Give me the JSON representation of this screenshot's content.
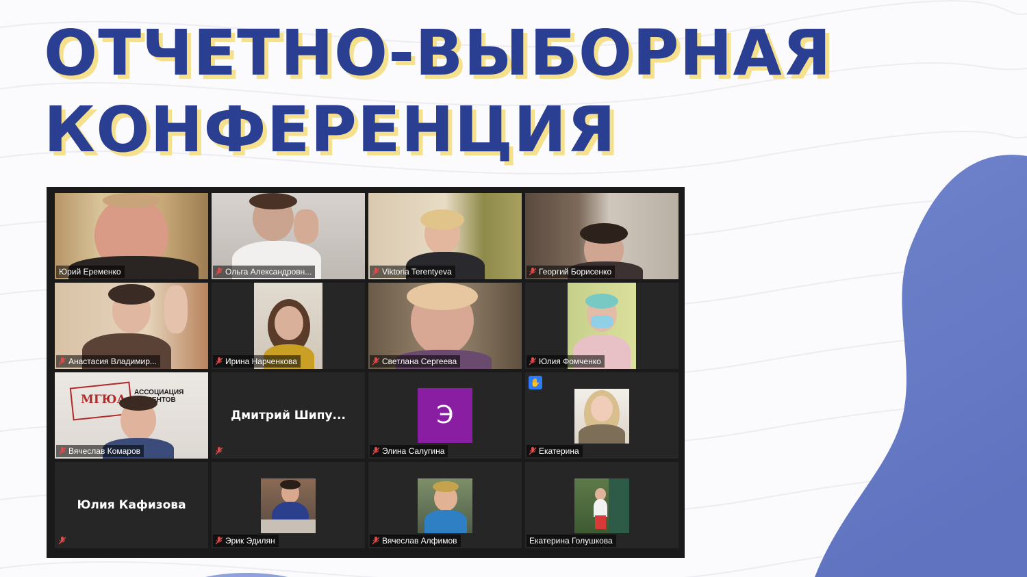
{
  "slide": {
    "title_line1": "ОТЧЕТНО-ВЫБОРНАЯ",
    "title_line2": "КОНФЕРЕНЦИЯ"
  },
  "colors": {
    "title": "#2a3f92",
    "title_shadow": "#f5e08e",
    "blob": "#6f82c8",
    "active_speaker_border": "#e6e24f",
    "avatar_purple": "#8a1ea3",
    "raise_hand": "#2d7cf6"
  },
  "meeting": {
    "participants": [
      {
        "name": "Юрий Еременко",
        "mic": "on",
        "active": true
      },
      {
        "name": "Ольга Александровн...",
        "mic": "muted"
      },
      {
        "name": "Viktoria Terentyeva",
        "mic": "muted"
      },
      {
        "name": "Георгий Борисенко",
        "mic": "muted"
      },
      {
        "name": "Анастасия Владимир...",
        "mic": "muted"
      },
      {
        "name": "Ирина Нарченкова",
        "mic": "muted"
      },
      {
        "name": "Светлана Сергеева",
        "mic": "muted"
      },
      {
        "name": "Юлия Фомченко",
        "mic": "muted"
      },
      {
        "name": "Вячеслав Комаров",
        "mic": "muted",
        "banner_text_1": "МГЮА",
        "banner_text_2": "АССОЦИАЦИЯ СТУДЕНТОВ"
      },
      {
        "display_name": "Дмитрий Шипу...",
        "mic": "muted",
        "video": "off"
      },
      {
        "name": "Элина Салугина",
        "mic": "muted",
        "avatar_letter": "Э"
      },
      {
        "name": "Екатерина",
        "mic": "muted",
        "hand_raised": true,
        "hand_icon": "raised-hand-icon"
      },
      {
        "display_name": "Юлия Кафизова",
        "mic": "muted",
        "video": "off"
      },
      {
        "name": "Эрик Эдилян",
        "mic": "muted"
      },
      {
        "name": "Вячеслав Алфимов",
        "mic": "muted"
      },
      {
        "name": "Екатерина Голушкова",
        "mic": "on"
      }
    ]
  }
}
